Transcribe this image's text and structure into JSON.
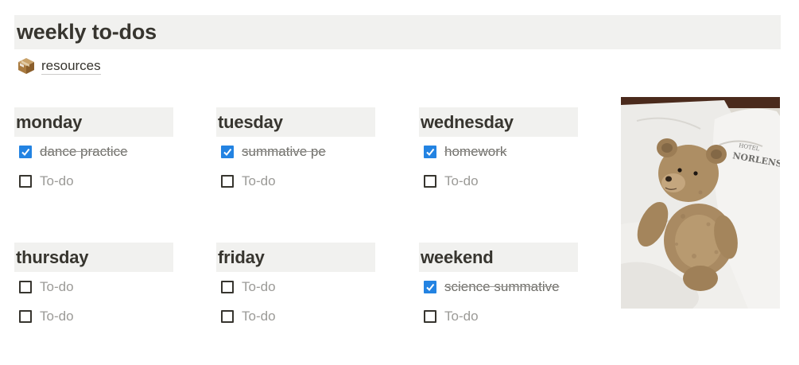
{
  "page": {
    "title": "weekly to-dos"
  },
  "resources": {
    "label": "resources",
    "icon": "package-icon"
  },
  "days": [
    {
      "name": "monday",
      "todos": [
        {
          "text": "dance practice",
          "checked": true
        },
        {
          "text": "To-do",
          "checked": false
        }
      ]
    },
    {
      "name": "tuesday",
      "todos": [
        {
          "text": "summative pe",
          "checked": true
        },
        {
          "text": "To-do",
          "checked": false
        }
      ]
    },
    {
      "name": "wednesday",
      "todos": [
        {
          "text": "homework",
          "checked": true
        },
        {
          "text": "To-do",
          "checked": false
        }
      ]
    },
    {
      "name": "thursday",
      "todos": [
        {
          "text": "To-do",
          "checked": false
        },
        {
          "text": "To-do",
          "checked": false
        }
      ]
    },
    {
      "name": "friday",
      "todos": [
        {
          "text": "To-do",
          "checked": false
        },
        {
          "text": "To-do",
          "checked": false
        }
      ]
    },
    {
      "name": "weekend",
      "todos": [
        {
          "text": "science summative",
          "checked": true
        },
        {
          "text": "To-do",
          "checked": false
        }
      ]
    }
  ],
  "image": {
    "pillow_text_1": "HOTEL",
    "pillow_text_2": "NORLENSE"
  },
  "colors": {
    "checkbox_checked": "#2383e2",
    "block_background": "#f1f1ef",
    "text": "#37352f"
  }
}
